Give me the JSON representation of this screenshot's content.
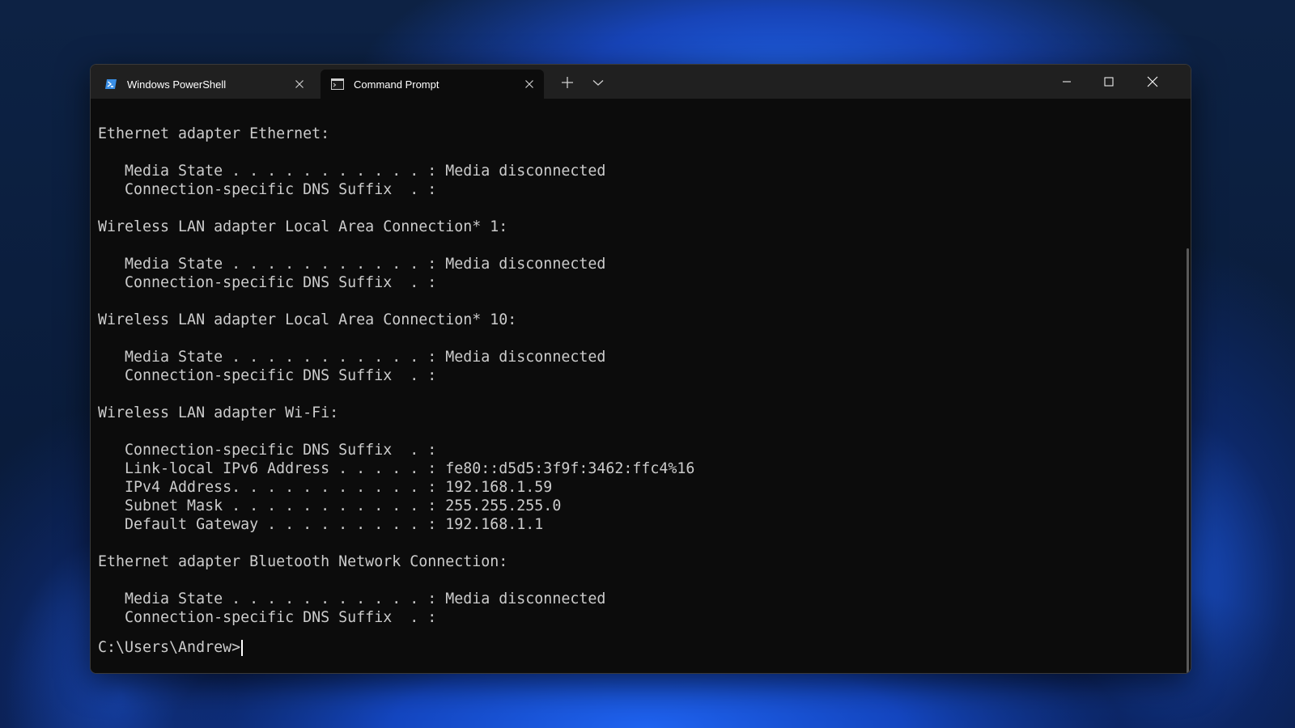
{
  "window": {
    "tabs": [
      {
        "label": "Windows PowerShell",
        "icon": "powershell-icon",
        "active": false
      },
      {
        "label": "Command Prompt",
        "icon": "cmd-icon",
        "active": true
      }
    ]
  },
  "terminal": {
    "lines": [
      "Ethernet adapter Ethernet:",
      "",
      "   Media State . . . . . . . . . . . : Media disconnected",
      "   Connection-specific DNS Suffix  . :",
      "",
      "Wireless LAN adapter Local Area Connection* 1:",
      "",
      "   Media State . . . . . . . . . . . : Media disconnected",
      "   Connection-specific DNS Suffix  . :",
      "",
      "Wireless LAN adapter Local Area Connection* 10:",
      "",
      "   Media State . . . . . . . . . . . : Media disconnected",
      "   Connection-specific DNS Suffix  . :",
      "",
      "Wireless LAN adapter Wi-Fi:",
      "",
      "   Connection-specific DNS Suffix  . :",
      "   Link-local IPv6 Address . . . . . : fe80::d5d5:3f9f:3462:ffc4%16",
      "   IPv4 Address. . . . . . . . . . . : 192.168.1.59",
      "   Subnet Mask . . . . . . . . . . . : 255.255.255.0",
      "   Default Gateway . . . . . . . . . : 192.168.1.1",
      "",
      "Ethernet adapter Bluetooth Network Connection:",
      "",
      "   Media State . . . . . . . . . . . : Media disconnected",
      "   Connection-specific DNS Suffix  . :"
    ],
    "prompt": "C:\\Users\\Andrew>"
  },
  "colors": {
    "terminal_bg": "#0c0c0c",
    "terminal_fg": "#cccccc",
    "titlebar_bg": "#202020",
    "accent_desktop": "#1f5fe0"
  }
}
